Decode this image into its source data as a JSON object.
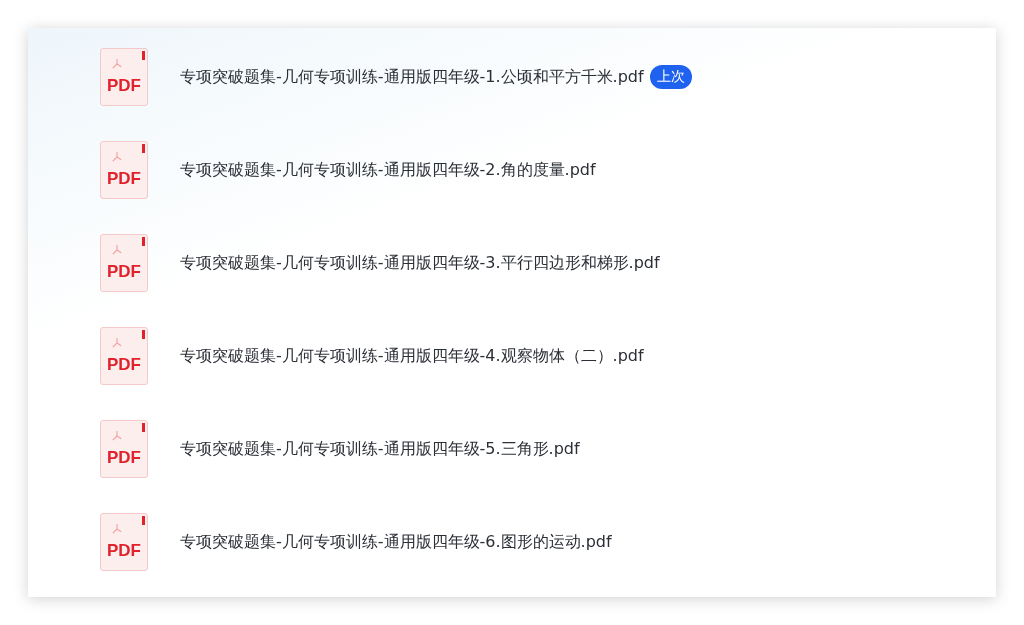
{
  "files": [
    {
      "icon_label": "PDF",
      "name": "专项突破题集-几何专项训练-通用版四年级-1.公顷和平方千米.pdf",
      "badge": "上次"
    },
    {
      "icon_label": "PDF",
      "name": "专项突破题集-几何专项训练-通用版四年级-2.角的度量.pdf"
    },
    {
      "icon_label": "PDF",
      "name": "专项突破题集-几何专项训练-通用版四年级-3.平行四边形和梯形.pdf"
    },
    {
      "icon_label": "PDF",
      "name": "专项突破题集-几何专项训练-通用版四年级-4.观察物体（二）.pdf"
    },
    {
      "icon_label": "PDF",
      "name": "专项突破题集-几何专项训练-通用版四年级-5.三角形.pdf"
    },
    {
      "icon_label": "PDF",
      "name": "专项突破题集-几何专项训练-通用版四年级-6.图形的运动.pdf"
    }
  ]
}
